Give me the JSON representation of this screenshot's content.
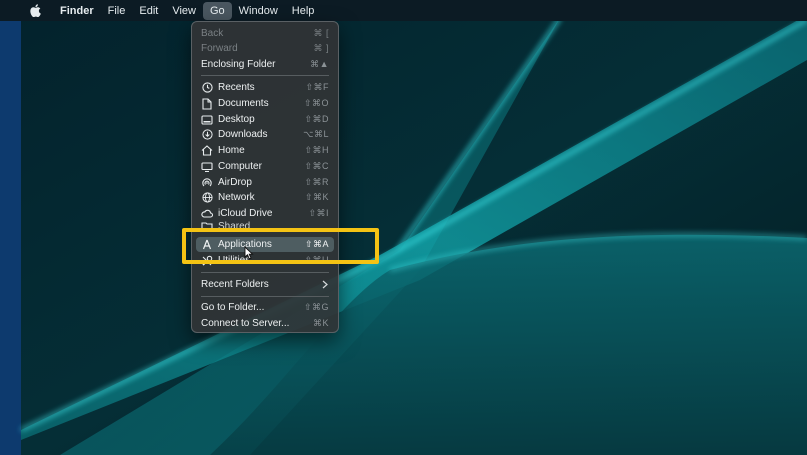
{
  "menubar": {
    "app": "Finder",
    "items": [
      "File",
      "Edit",
      "View",
      "Go",
      "Window",
      "Help"
    ]
  },
  "go_menu": {
    "back": {
      "label": "Back",
      "shortcut": "⌘ ["
    },
    "forward": {
      "label": "Forward",
      "shortcut": "⌘ ]"
    },
    "enclosing": {
      "label": "Enclosing Folder",
      "shortcut": "⌘▲"
    },
    "places": [
      {
        "label": "Recents",
        "shortcut": "⇧⌘F",
        "icon": "clock-icon"
      },
      {
        "label": "Documents",
        "shortcut": "⇧⌘O",
        "icon": "document-icon"
      },
      {
        "label": "Desktop",
        "shortcut": "⇧⌘D",
        "icon": "desktop-icon"
      },
      {
        "label": "Downloads",
        "shortcut": "⌥⌘L",
        "icon": "download-icon"
      },
      {
        "label": "Home",
        "shortcut": "⇧⌘H",
        "icon": "home-icon"
      },
      {
        "label": "Computer",
        "shortcut": "⇧⌘C",
        "icon": "computer-icon"
      },
      {
        "label": "AirDrop",
        "shortcut": "⇧⌘R",
        "icon": "airdrop-icon"
      },
      {
        "label": "Network",
        "shortcut": "⇧⌘K",
        "icon": "network-icon"
      },
      {
        "label": "iCloud Drive",
        "shortcut": "⇧⌘I",
        "icon": "cloud-icon"
      },
      {
        "label": "Shared",
        "shortcut": "",
        "icon": "shared-folder-icon"
      },
      {
        "label": "Applications",
        "shortcut": "⇧⌘A",
        "icon": "applications-icon"
      },
      {
        "label": "Utilities",
        "shortcut": "⇧⌘U",
        "icon": "utilities-icon"
      }
    ],
    "recent_folders": "Recent Folders",
    "go_to_folder": {
      "label": "Go to Folder...",
      "shortcut": "⇧⌘G"
    },
    "connect": {
      "label": "Connect to Server...",
      "shortcut": "⌘K"
    }
  },
  "colors": {
    "callout": "#f4c314",
    "highlight": "#4e5d61",
    "menubar": "#0c1b24"
  }
}
